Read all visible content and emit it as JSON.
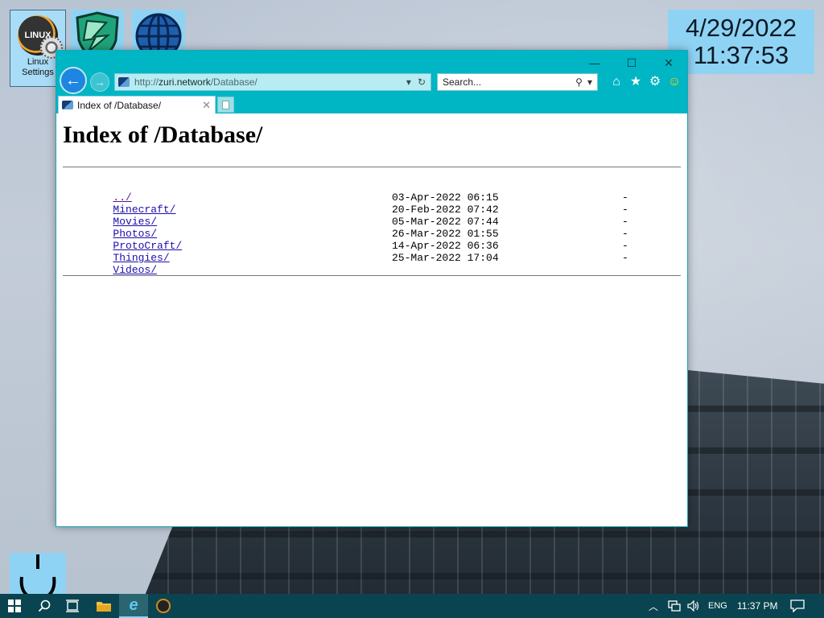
{
  "desktop": {
    "icons": [
      {
        "label": "Linux\nSettings",
        "label_line1": "Linux",
        "label_line2": "Settings",
        "icon": "linux-settings-icon"
      },
      {
        "icon": "shield-icon"
      },
      {
        "icon": "globe-icon"
      }
    ],
    "clock": {
      "date": "4/29/2022",
      "time": "11:37:53"
    },
    "power": {
      "icon": "power-icon"
    }
  },
  "browser": {
    "window_controls": {
      "minimize": "—",
      "maximize": "☐",
      "close": "✕"
    },
    "address": {
      "prefix": "http://",
      "host": "zuri.network",
      "path": "/Database/"
    },
    "search": {
      "placeholder": "Search..."
    },
    "tab": {
      "title": "Index of /Database/"
    },
    "colors": {
      "chrome": "#00b5c4",
      "link": "#1a0dab",
      "visited": "#551a8b"
    }
  },
  "page": {
    "heading": "Index of /Database/",
    "parent": "../",
    "entries": [
      {
        "name": "Minecraft/",
        "date": "03-Apr-2022 06:15",
        "size": "-"
      },
      {
        "name": "Movies/",
        "date": "20-Feb-2022 07:42",
        "size": "-"
      },
      {
        "name": "Photos/",
        "date": "05-Mar-2022 07:44",
        "size": "-"
      },
      {
        "name": "ProtoCraft/",
        "date": "26-Mar-2022 01:55",
        "size": "-"
      },
      {
        "name": "Thingies/",
        "date": "14-Apr-2022 06:36",
        "size": "-"
      },
      {
        "name": "Videos/",
        "date": "25-Mar-2022 17:04",
        "size": "-"
      }
    ]
  },
  "taskbar": {
    "language": "ENG",
    "time": "11:37 PM"
  }
}
